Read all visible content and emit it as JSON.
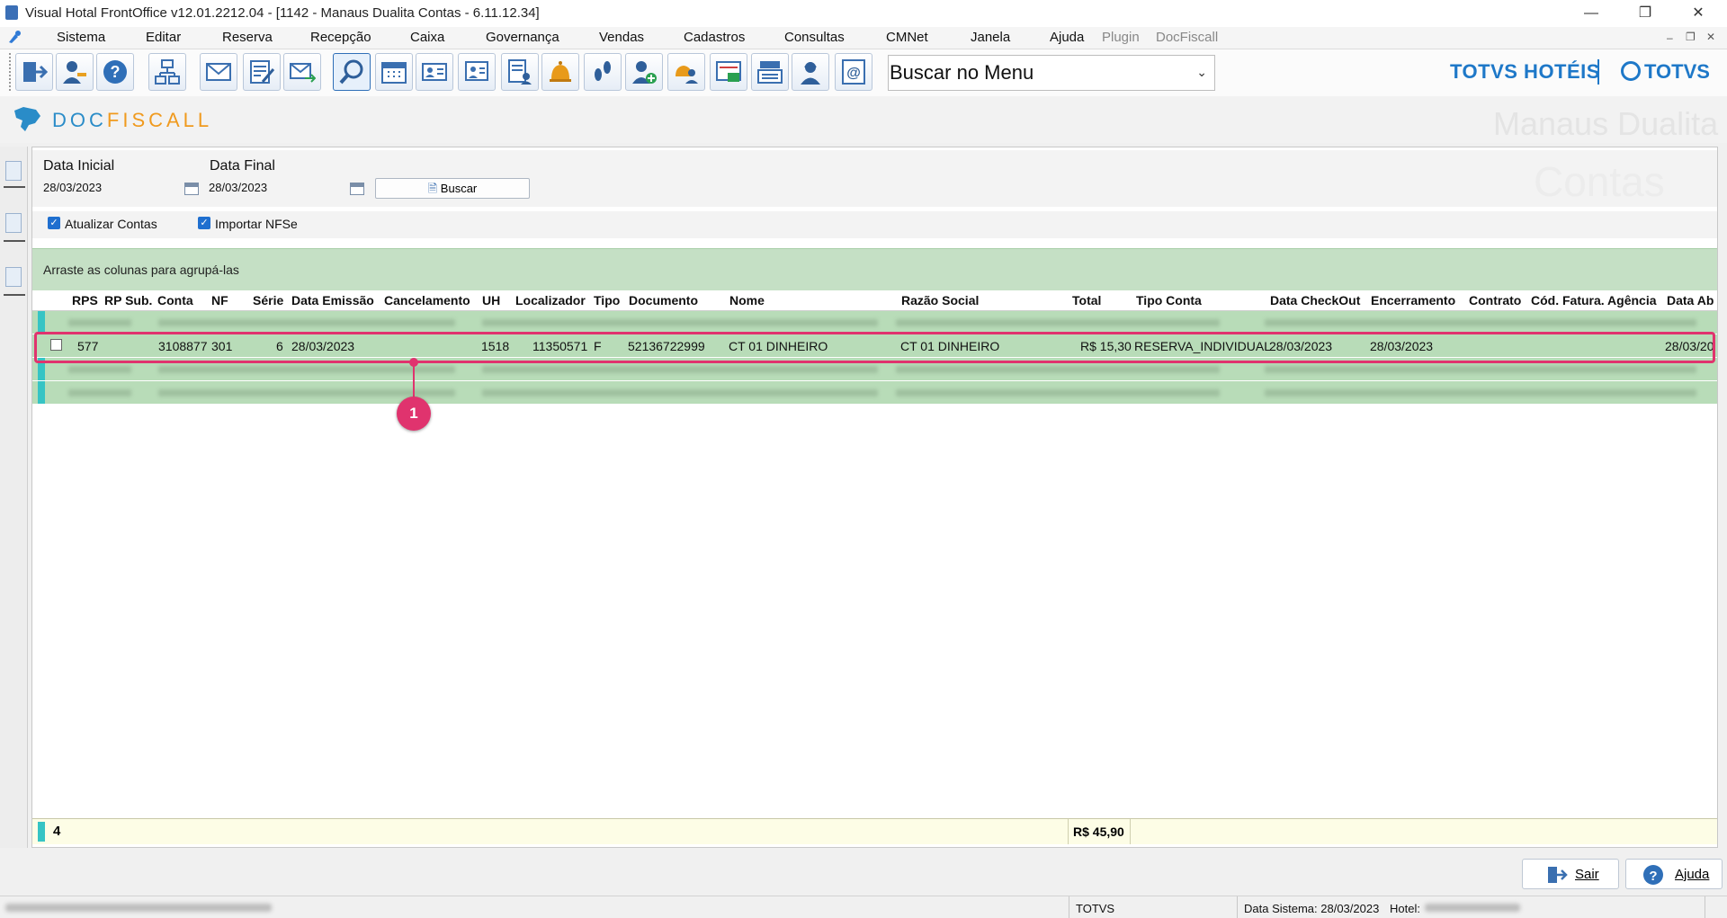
{
  "window": {
    "title": "Visual Hotal FrontOffice v12.01.2212.04 - [1142 - Manaus Dualita Contas - 6.11.12.34]",
    "minimize": "—",
    "restore": "❐",
    "close": "✕"
  },
  "menu": [
    "Sistema",
    "Editar",
    "Reserva",
    "Recepção",
    "Caixa",
    "Governança",
    "Vendas",
    "Cadastros",
    "Consultas",
    "CMNet",
    "Janela",
    "Ajuda",
    "Plugin",
    "DocFiscall"
  ],
  "menu_search": {
    "value": "Buscar no Menu"
  },
  "brand": {
    "hoteis": "TOTVS HOTÉIS",
    "totvs": "TOTVS"
  },
  "module": {
    "name_part1": "DOC",
    "name_part2": "FISCALL",
    "hotel_watermark": "Manaus Dualita",
    "screen_watermark": "Contas"
  },
  "filters": {
    "data_inicial_label": "Data Inicial",
    "data_inicial": "28/03/2023",
    "data_final_label": "Data Final",
    "data_final": "28/03/2023",
    "buscar": "Buscar",
    "atualizar_contas": "Atualizar Contas",
    "importar_nfse": "Importar NFSe"
  },
  "grid": {
    "group_hint": "Arraste as colunas para agrupá-las",
    "columns": [
      "RPS",
      "RP Sub.",
      "Conta",
      "NF",
      "Série",
      "Data Emissão",
      "Cancelamento",
      "UH",
      "Localizador",
      "Tipo",
      "Documento",
      "Nome",
      "Razão Social",
      "Total",
      "Tipo Conta",
      "Data CheckOut",
      "Encerramento",
      "Contrato",
      "Cód. Fatura. Agência",
      "Data Ab"
    ],
    "selected_row": {
      "rps": "577",
      "conta": "3108877",
      "nf": "301",
      "serie": "6",
      "data_emissao": "28/03/2023",
      "uh": "1518",
      "localizador": "11350571",
      "tipo": "F",
      "documento": "52136722999",
      "nome": "CT 01 DINHEIRO",
      "razao_social": "CT 01 DINHEIRO",
      "total": "R$ 15,30",
      "tipo_conta": "RESERVA_INDIVIDUAL",
      "data_checkout": "28/03/2023",
      "encerramento": "28/03/2023",
      "data_ab": "28/03/20"
    },
    "footer_count": "4",
    "footer_total": "R$ 45,90"
  },
  "callout": "1",
  "buttons": {
    "sair": "Sair",
    "ajuda": "Ajuda"
  },
  "status": {
    "company": "TOTVS",
    "data_sistema": "Data Sistema: 28/03/2023",
    "hotel": "Hotel:"
  }
}
